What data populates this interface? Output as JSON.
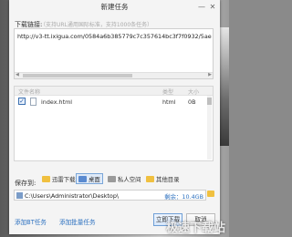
{
  "dialog": {
    "title": "新建任务",
    "minimize_glyph": "—",
    "close_glyph": "✕"
  },
  "url_section": {
    "label": "下载链接:",
    "hint": "（支持URL通用国际标准，支持1000条任务）",
    "value": "http://v3-tt.ixigua.com/0584a6b385779c7c357614bc3f7f0932/5aec063b/vic"
  },
  "files_section": {
    "columns": [
      "文件名称",
      "类型",
      "大小"
    ],
    "rows": [
      {
        "checked": true,
        "name": "index.html",
        "type": "html",
        "size": "0B"
      }
    ]
  },
  "save_section": {
    "label": "保存到:",
    "locations": [
      {
        "label": "迅雷下载",
        "icon": "folder-icon",
        "active": false
      },
      {
        "label": "桌面",
        "icon": "desktop-folder-icon",
        "active": true
      },
      {
        "label": "私人空间",
        "icon": "private-space-icon",
        "active": false
      },
      {
        "label": "其他目录",
        "icon": "folder-icon",
        "active": false
      }
    ],
    "path": "C:\\Users\\Administrator\\Desktop\\",
    "space": "剩余：10.4GB"
  },
  "footer": {
    "add_bt": "添加BT任务",
    "add_batch": "添加批量任务",
    "download_now": "立即下载",
    "cancel": "取消"
  },
  "watermark": "极速下载站",
  "colors": {
    "accent": "#2a6fbf",
    "dialog_bg": "#f4f4f4"
  }
}
